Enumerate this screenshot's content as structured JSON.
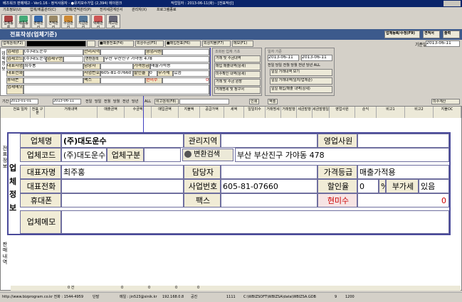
{
  "window": {
    "title": "베즈워크 판매재고 - Ver1.16 - 정식사용자 - ●유지보수가입 (2,394) 에이원크",
    "date": "작업일자 : 2013-06-11(화) - [전표작성]"
  },
  "menu": [
    "기초정보(U)",
    "업체/제품관리(C)",
    "판매/견적관리(P)",
    "전자세금계산서",
    "관리자(X)",
    "프로그램종료"
  ],
  "toolbar": [
    "업체등록",
    "제품등록",
    "판매관리",
    "견적관리",
    "수금관리",
    "지급관리",
    "택배관리",
    "재고관리"
  ],
  "window_title": "전표작성(업체기준)",
  "topright_buttons": [
    "업체등록/수정(F9)",
    "견적서",
    "출력"
  ],
  "subbar": {
    "search_label": "업체검색(F2)",
    "buttons": [
      "■매출전표(F4)",
      "외상수금(F5)",
      "■매입전표(F6)",
      "외상지불(F7)",
      "메모(F1)"
    ],
    "base_date_label": "기준일",
    "base_date": "2013-06-11"
  },
  "small_info": {
    "rows": [
      [
        "업체명",
        "(주)대도운수",
        "관리지역",
        "영업사원"
      ],
      [
        "업체코드",
        "(주)대도운수",
        "업체구분",
        "변환검색",
        "부산 부산진구 가야동 478"
      ],
      [
        "대표자명",
        "최주홍",
        "담당자",
        "가격등급",
        "매출가적용"
      ],
      [
        "대표전화",
        "",
        "사업번호",
        "605-81-07660",
        "할인율",
        "0",
        "부가세",
        "있음"
      ],
      [
        "휴대폰",
        "",
        "팩스",
        "",
        "현미수",
        "0"
      ],
      [
        "업체메모",
        ""
      ]
    ]
  },
  "side_label": [
    "업",
    "체",
    "정",
    "보"
  ],
  "inquiry": {
    "title": "조회된 업체 기초",
    "buttons": [
      "거래 및 수금내역",
      "매입 매출내역(상세)",
      "미수확인 내역(상세)",
      "거래 및 수금 원장",
      "거래명세 및 청구서"
    ]
  },
  "right_box": {
    "title": "일자 기준",
    "from": "2013-06-11",
    "to": "2013-06-11",
    "periods": [
      "전일",
      "당일",
      "전월",
      "당월",
      "전년",
      "당년",
      "ALL"
    ],
    "buttons": [
      "일일 거래내역 보기",
      "일일 거래내역(일자/업체순)",
      "일일 매입/매출 내역(상세)"
    ]
  },
  "period_bar": {
    "label": "기간",
    "from": "2013-01-01",
    "to": "2013-06-11",
    "options": [
      "전일",
      "당일",
      "전월",
      "당월",
      "전년",
      "당년",
      "ALL"
    ],
    "remark_label": "비고검색(F8)",
    "print": "인쇄",
    "excel": "엑셀",
    "tax": "미수계산"
  },
  "columns": [
    "전표 일자",
    "전표 구분",
    "거래내역",
    "매출금액",
    "수금액",
    "매입금액",
    "지불액",
    "공급가액",
    "세액",
    "일일미수",
    "거래명세",
    "거래발행",
    "세금발행",
    "세금발행일",
    "영업사원",
    "순익",
    "비고1",
    "비고2",
    "지불OC"
  ],
  "detail": {
    "company_label": "업체명",
    "company": "(주)대도운수",
    "area_label": "관리지역",
    "area": "",
    "sales_label": "영업사원",
    "sales": "",
    "code_label": "업체코드",
    "code": "(주)대도운수",
    "type_label": "업체구분",
    "type": "",
    "convert": "변환검색",
    "address": "부산 부산진구 가야동 478",
    "ceo_label": "대표자명",
    "ceo": "최주홍",
    "manager_label": "담당자",
    "manager": "",
    "grade_label": "가격등급",
    "grade": "매출가적용",
    "phone_label": "대표전화",
    "phone": "",
    "bizno_label": "사업번호",
    "bizno": "605-81-07660",
    "discount_label": "할인율",
    "discount": "0",
    "vat_sep": "%",
    "vat_label": "부가세",
    "vat": "있음",
    "mobile_label": "휴대폰",
    "mobile": "",
    "fax_label": "팩스",
    "fax": "",
    "unpaid_label": "현미수",
    "unpaid": "0",
    "memo_label": "업체메모",
    "memo": ""
  },
  "big_side": [
    "업",
    "체",
    "정",
    "보"
  ],
  "left_side": [
    "전",
    "표",
    "정",
    "보"
  ],
  "left_side2": [
    "판",
    "매",
    "내",
    "역"
  ],
  "footer_totals": [
    "0",
    "0",
    "0",
    "0"
  ],
  "footer_note": "0 건",
  "status": [
    "http://www.bizprogram.co.kr 전화 : 1544-4959",
    "단말",
    "메일 : jin523@sinik.kr",
    "192.168.0.8",
    "공진",
    "1111",
    "C:\\WBIZSOFT\\WBIZSA\\data\\WBIZSA.GDB",
    "9",
    "1200"
  ]
}
